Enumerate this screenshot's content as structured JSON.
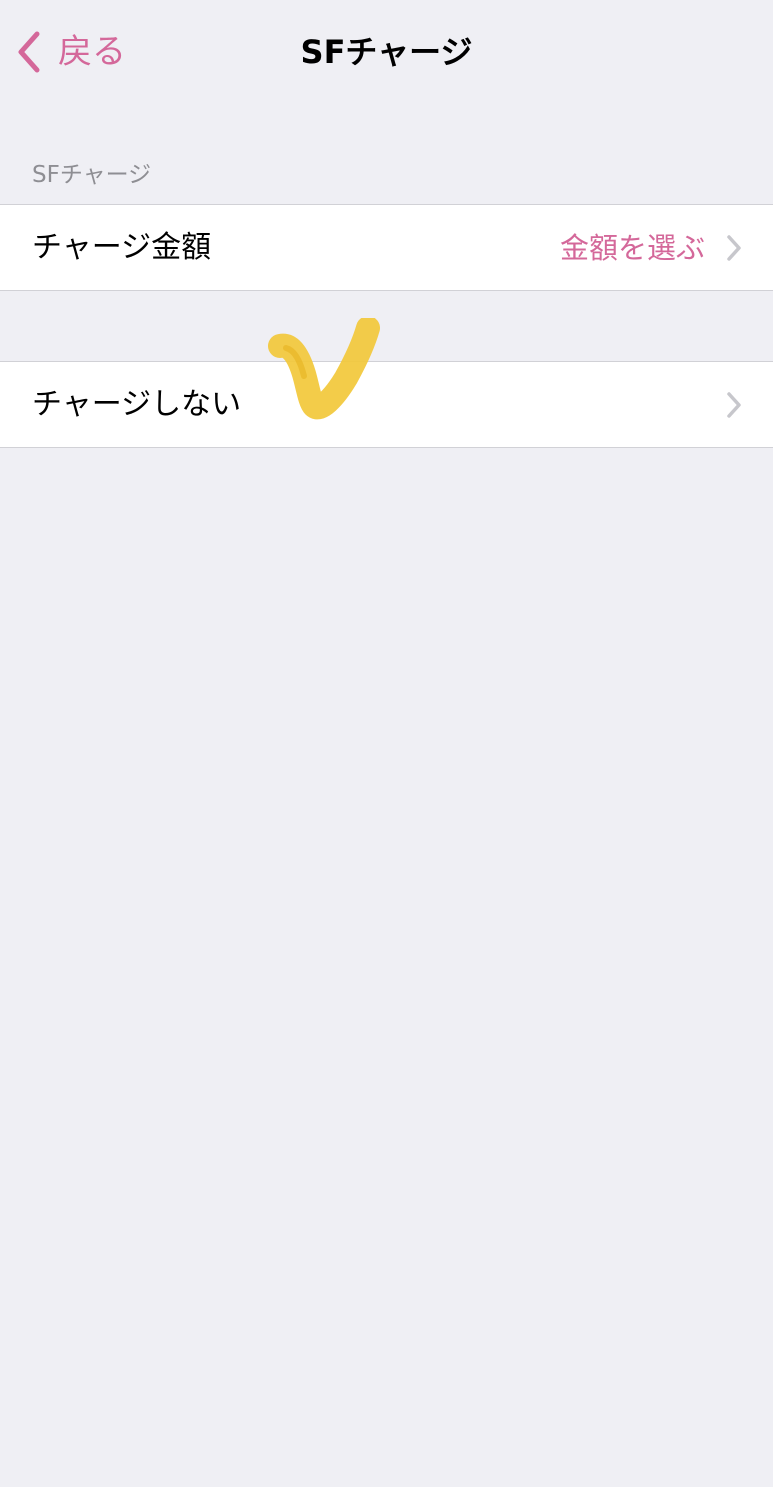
{
  "nav": {
    "back_label": "戻る",
    "title": "SFチャージ"
  },
  "section": {
    "header": "SFチャージ"
  },
  "rows": [
    {
      "label": "チャージ金額",
      "detail": "金額を選ぶ"
    },
    {
      "label": "チャージしない",
      "detail": ""
    }
  ],
  "colors": {
    "accent": "#d4689a",
    "background": "#efeff4",
    "cell_background": "#ffffff",
    "separator": "#d1d1d6",
    "section_header": "#8e8e93",
    "chevron": "#c7c7cc",
    "checkmark_highlight": "#f2c83a"
  },
  "icons": {
    "back": "chevron-left-icon",
    "row_chevron": "chevron-right-icon",
    "selection_mark": "checkmark-icon"
  }
}
